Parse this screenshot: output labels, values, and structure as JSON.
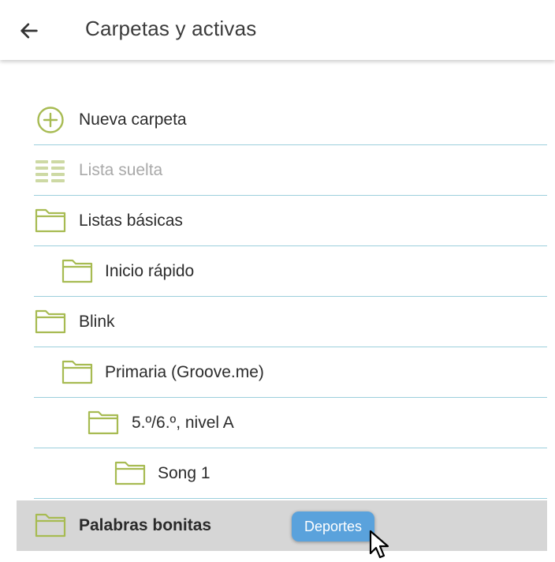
{
  "header": {
    "title": "Carpetas y activas",
    "back_icon": "arrow-left-icon"
  },
  "colors": {
    "accent": "#a7bb52",
    "divider": "#9ccfdc",
    "selected_bg": "#d6d6d6",
    "chip_bg": "#5aa2dc"
  },
  "list": {
    "items": [
      {
        "label": "Nueva carpeta",
        "icon": "add-circle-icon"
      },
      {
        "label": "Lista suelta",
        "icon": "list-icon"
      },
      {
        "label": "Listas básicas",
        "icon": "folder-icon"
      },
      {
        "label": "Inicio rápido",
        "icon": "folder-icon"
      },
      {
        "label": "Blink",
        "icon": "folder-icon"
      },
      {
        "label": "Primaria (Groove.me)",
        "icon": "folder-icon"
      },
      {
        "label": "5.º/6.º, nivel A",
        "icon": "folder-icon"
      },
      {
        "label": "Song 1",
        "icon": "folder-icon"
      },
      {
        "label": "Palabras bonitas",
        "icon": "folder-icon"
      }
    ]
  },
  "drag": {
    "label": "Deportes",
    "cursor_icon": "mouse-pointer-icon"
  }
}
